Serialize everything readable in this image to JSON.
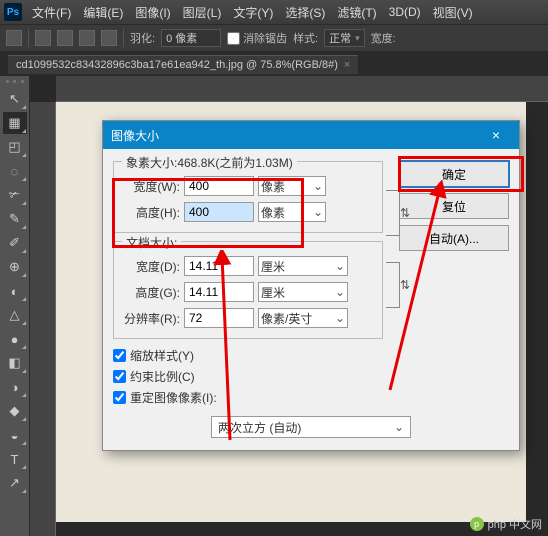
{
  "menubar": {
    "items": [
      "文件(F)",
      "编辑(E)",
      "图像(I)",
      "图层(L)",
      "文字(Y)",
      "选择(S)",
      "滤镜(T)",
      "3D(D)",
      "视图(V)"
    ]
  },
  "optbar": {
    "feather_label": "羽化:",
    "feather_value": "0 像素",
    "antialias_label": "消除锯齿",
    "style_label": "样式:",
    "style_value": "正常",
    "width_label": "宽度:"
  },
  "tab": {
    "title": "cd1099532c83432896c3ba17e61ea942_th.jpg @ 75.8%(RGB/8#)"
  },
  "dialog": {
    "title": "图像大小",
    "pixel_group_legend": "象素大小:468.8K(之前为1.03M)",
    "width_label": "宽度(W):",
    "height_label": "高度(H):",
    "width_value": "400",
    "height_value": "400",
    "unit_px": "像素",
    "doc_group_legend": "文档大小:",
    "doc_width_label": "宽度(D):",
    "doc_height_label": "高度(G):",
    "doc_width_value": "14.11",
    "doc_height_value": "14.11",
    "unit_cm": "厘米",
    "res_label": "分辨率(R):",
    "res_value": "72",
    "res_unit": "像素/英寸",
    "scale_styles": "缩放样式(Y)",
    "constrain": "约束比例(C)",
    "resample": "重定图像像素(I):",
    "interp": "两次立方 (自动)",
    "ok": "确定",
    "reset": "复位",
    "auto": "自动(A)..."
  },
  "watermark": {
    "text": "php 中文网"
  },
  "tool_icons": [
    "↖",
    "▦",
    "◰",
    "◌",
    "✃",
    "✎",
    "✐",
    "⊕",
    "◐",
    "△",
    "●",
    "◧",
    "◑",
    "◆",
    "◒",
    "✎",
    "T",
    "↗"
  ],
  "colors": {
    "accent": "#0a84c7",
    "annotation": "#e80000"
  }
}
